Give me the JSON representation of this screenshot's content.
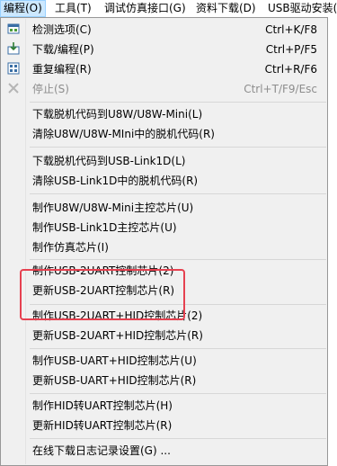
{
  "menubar": [
    {
      "label": "编程(O)",
      "active": true
    },
    {
      "label": "工具(T)"
    },
    {
      "label": "调试仿真接口(G)"
    },
    {
      "label": "资料下载(D)"
    },
    {
      "label": "USB驱动安装("
    }
  ],
  "menu": {
    "items": [
      {
        "label": "检测选项(C)",
        "shortcut": "Ctrl+K/F8",
        "icon": "detect-icon"
      },
      {
        "label": "下载/编程(P)",
        "shortcut": "Ctrl+P/F5",
        "icon": "download-program-icon"
      },
      {
        "label": "重复编程(R)",
        "shortcut": "Ctrl+R/F6",
        "icon": "repeat-program-icon"
      },
      {
        "label": "停止(S)",
        "shortcut": "Ctrl+T/F9/Esc",
        "icon": "stop-icon",
        "disabled": true
      },
      {
        "label": "下载脱机代码到U8W/U8W-Mini(L)"
      },
      {
        "label": "清除U8W/U8W-MIni中的脱机代码(R)"
      },
      {
        "label": "下载脱机代码到USB-Link1D(L)"
      },
      {
        "label": "清除USB-Link1D中的脱机代码(R)"
      },
      {
        "label": "制作U8W/U8W-Mini主控芯片(U)"
      },
      {
        "label": "制作USB-Link1D主控芯片(U)"
      },
      {
        "label": "制作仿真芯片(I)"
      },
      {
        "label": "制作USB-2UART控制芯片(2)"
      },
      {
        "label": "更新USB-2UART控制芯片(R)"
      },
      {
        "label": "制作USB-2UART+HID控制芯片(2)"
      },
      {
        "label": "更新USB-2UART+HID控制芯片(R)"
      },
      {
        "label": "制作USB-UART+HID控制芯片(U)"
      },
      {
        "label": "更新USB-UART+HID控制芯片(R)"
      },
      {
        "label": "制作HID转UART控制芯片(H)"
      },
      {
        "label": "更新HID转UART控制芯片(R)"
      },
      {
        "label": "在线下载日志记录设置(G) ..."
      }
    ]
  },
  "colors": {
    "highlight_border": "#e64150",
    "menu_background": "#f0f0f0"
  }
}
